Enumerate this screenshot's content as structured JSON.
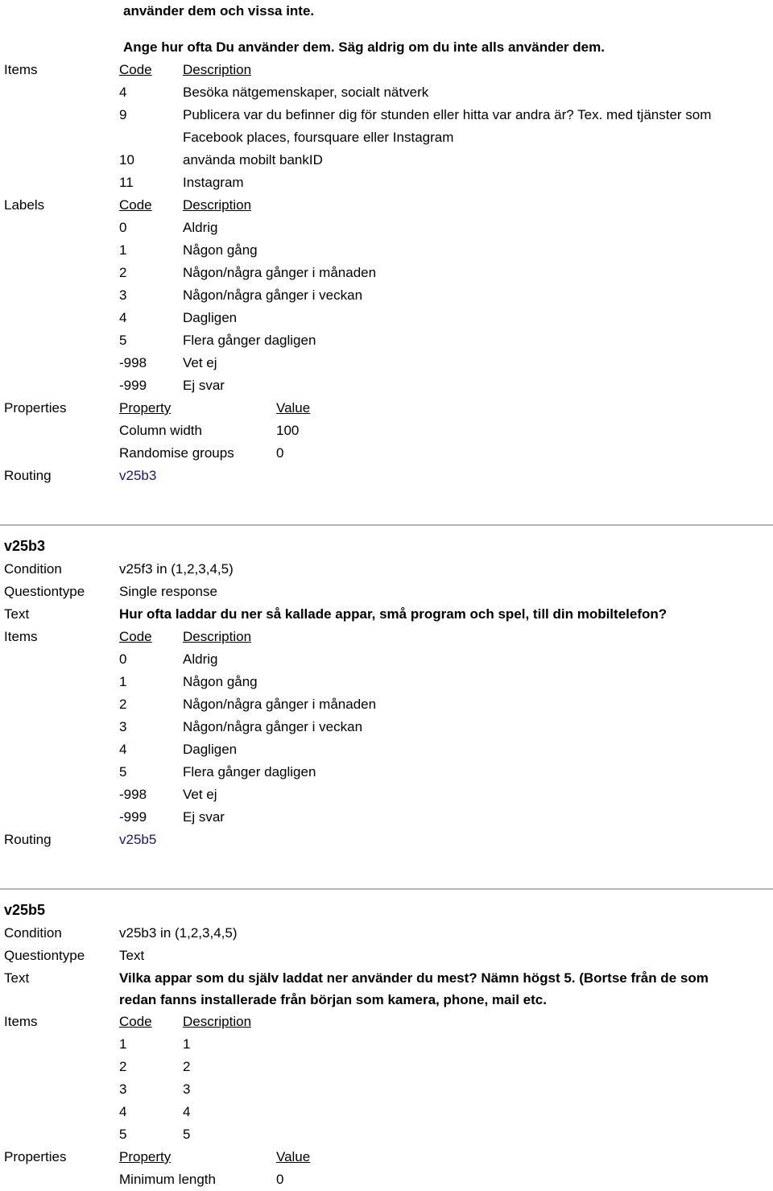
{
  "colors": {
    "text": "#000000",
    "link": "#191970",
    "separator": "#b5b5b5",
    "background": "#ffffff"
  },
  "labels": {
    "items": "Items",
    "labels": "Labels",
    "properties": "Properties",
    "routing": "Routing",
    "condition": "Condition",
    "questiontype": "Questiontype",
    "text": "Text"
  },
  "table_headers": {
    "code": "Code",
    "description": "Description",
    "property": "Property",
    "value": "Value"
  },
  "question_prev": {
    "intro_line_1": "använder dem och vissa inte.",
    "intro_line_2": "Ange hur ofta Du använder dem. Säg aldrig om du inte alls använder dem.",
    "items": [
      {
        "code": "4",
        "description": "Besöka nätgemenskaper, socialt nätverk"
      },
      {
        "code": "9",
        "description": "Publicera var du befinner dig för stunden eller hitta var andra är? Tex. med tjänster som Facebook places, foursquare eller Instagram"
      },
      {
        "code": "10",
        "description": "använda mobilt bankID"
      },
      {
        "code": "11",
        "description": "Instagram"
      }
    ],
    "labels": [
      {
        "code": "0",
        "description": "Aldrig"
      },
      {
        "code": "1",
        "description": "Någon gång"
      },
      {
        "code": "2",
        "description": "Någon/några gånger i månaden"
      },
      {
        "code": "3",
        "description": "Någon/några gånger i veckan"
      },
      {
        "code": "4",
        "description": "Dagligen"
      },
      {
        "code": "5",
        "description": "Flera gånger dagligen"
      },
      {
        "code": "-998",
        "description": "Vet ej"
      },
      {
        "code": "-999",
        "description": "Ej svar"
      }
    ],
    "properties": [
      {
        "property": "Column width",
        "value": "100"
      },
      {
        "property": "Randomise groups",
        "value": "0"
      }
    ],
    "routing": "v25b3"
  },
  "question_v25b3": {
    "title": "v25b3",
    "condition": "v25f3 in (1,2,3,4,5)",
    "questiontype": "Single response",
    "text": "Hur ofta laddar du ner så kallade appar, små program och spel, till din mobiltelefon?",
    "items": [
      {
        "code": "0",
        "description": "Aldrig"
      },
      {
        "code": "1",
        "description": "Någon gång"
      },
      {
        "code": "2",
        "description": "Någon/några gånger i månaden"
      },
      {
        "code": "3",
        "description": "Någon/några gånger i veckan"
      },
      {
        "code": "4",
        "description": "Dagligen"
      },
      {
        "code": "5",
        "description": "Flera gånger dagligen"
      },
      {
        "code": "-998",
        "description": "Vet ej"
      },
      {
        "code": "-999",
        "description": "Ej svar"
      }
    ],
    "routing": "v25b5"
  },
  "question_v25b5": {
    "title": "v25b5",
    "condition": "v25b3 in (1,2,3,4,5)",
    "questiontype": "Text",
    "text": "Vilka appar som du själv laddat ner använder du mest? Nämn högst 5. (Bortse från de som redan fanns installerade från början som kamera, phone, mail etc.",
    "items": [
      {
        "code": "1",
        "description": "1"
      },
      {
        "code": "2",
        "description": "2"
      },
      {
        "code": "3",
        "description": "3"
      },
      {
        "code": "4",
        "description": "4"
      },
      {
        "code": "5",
        "description": "5"
      }
    ],
    "properties": [
      {
        "property": "Minimum length",
        "value": "0"
      }
    ]
  }
}
